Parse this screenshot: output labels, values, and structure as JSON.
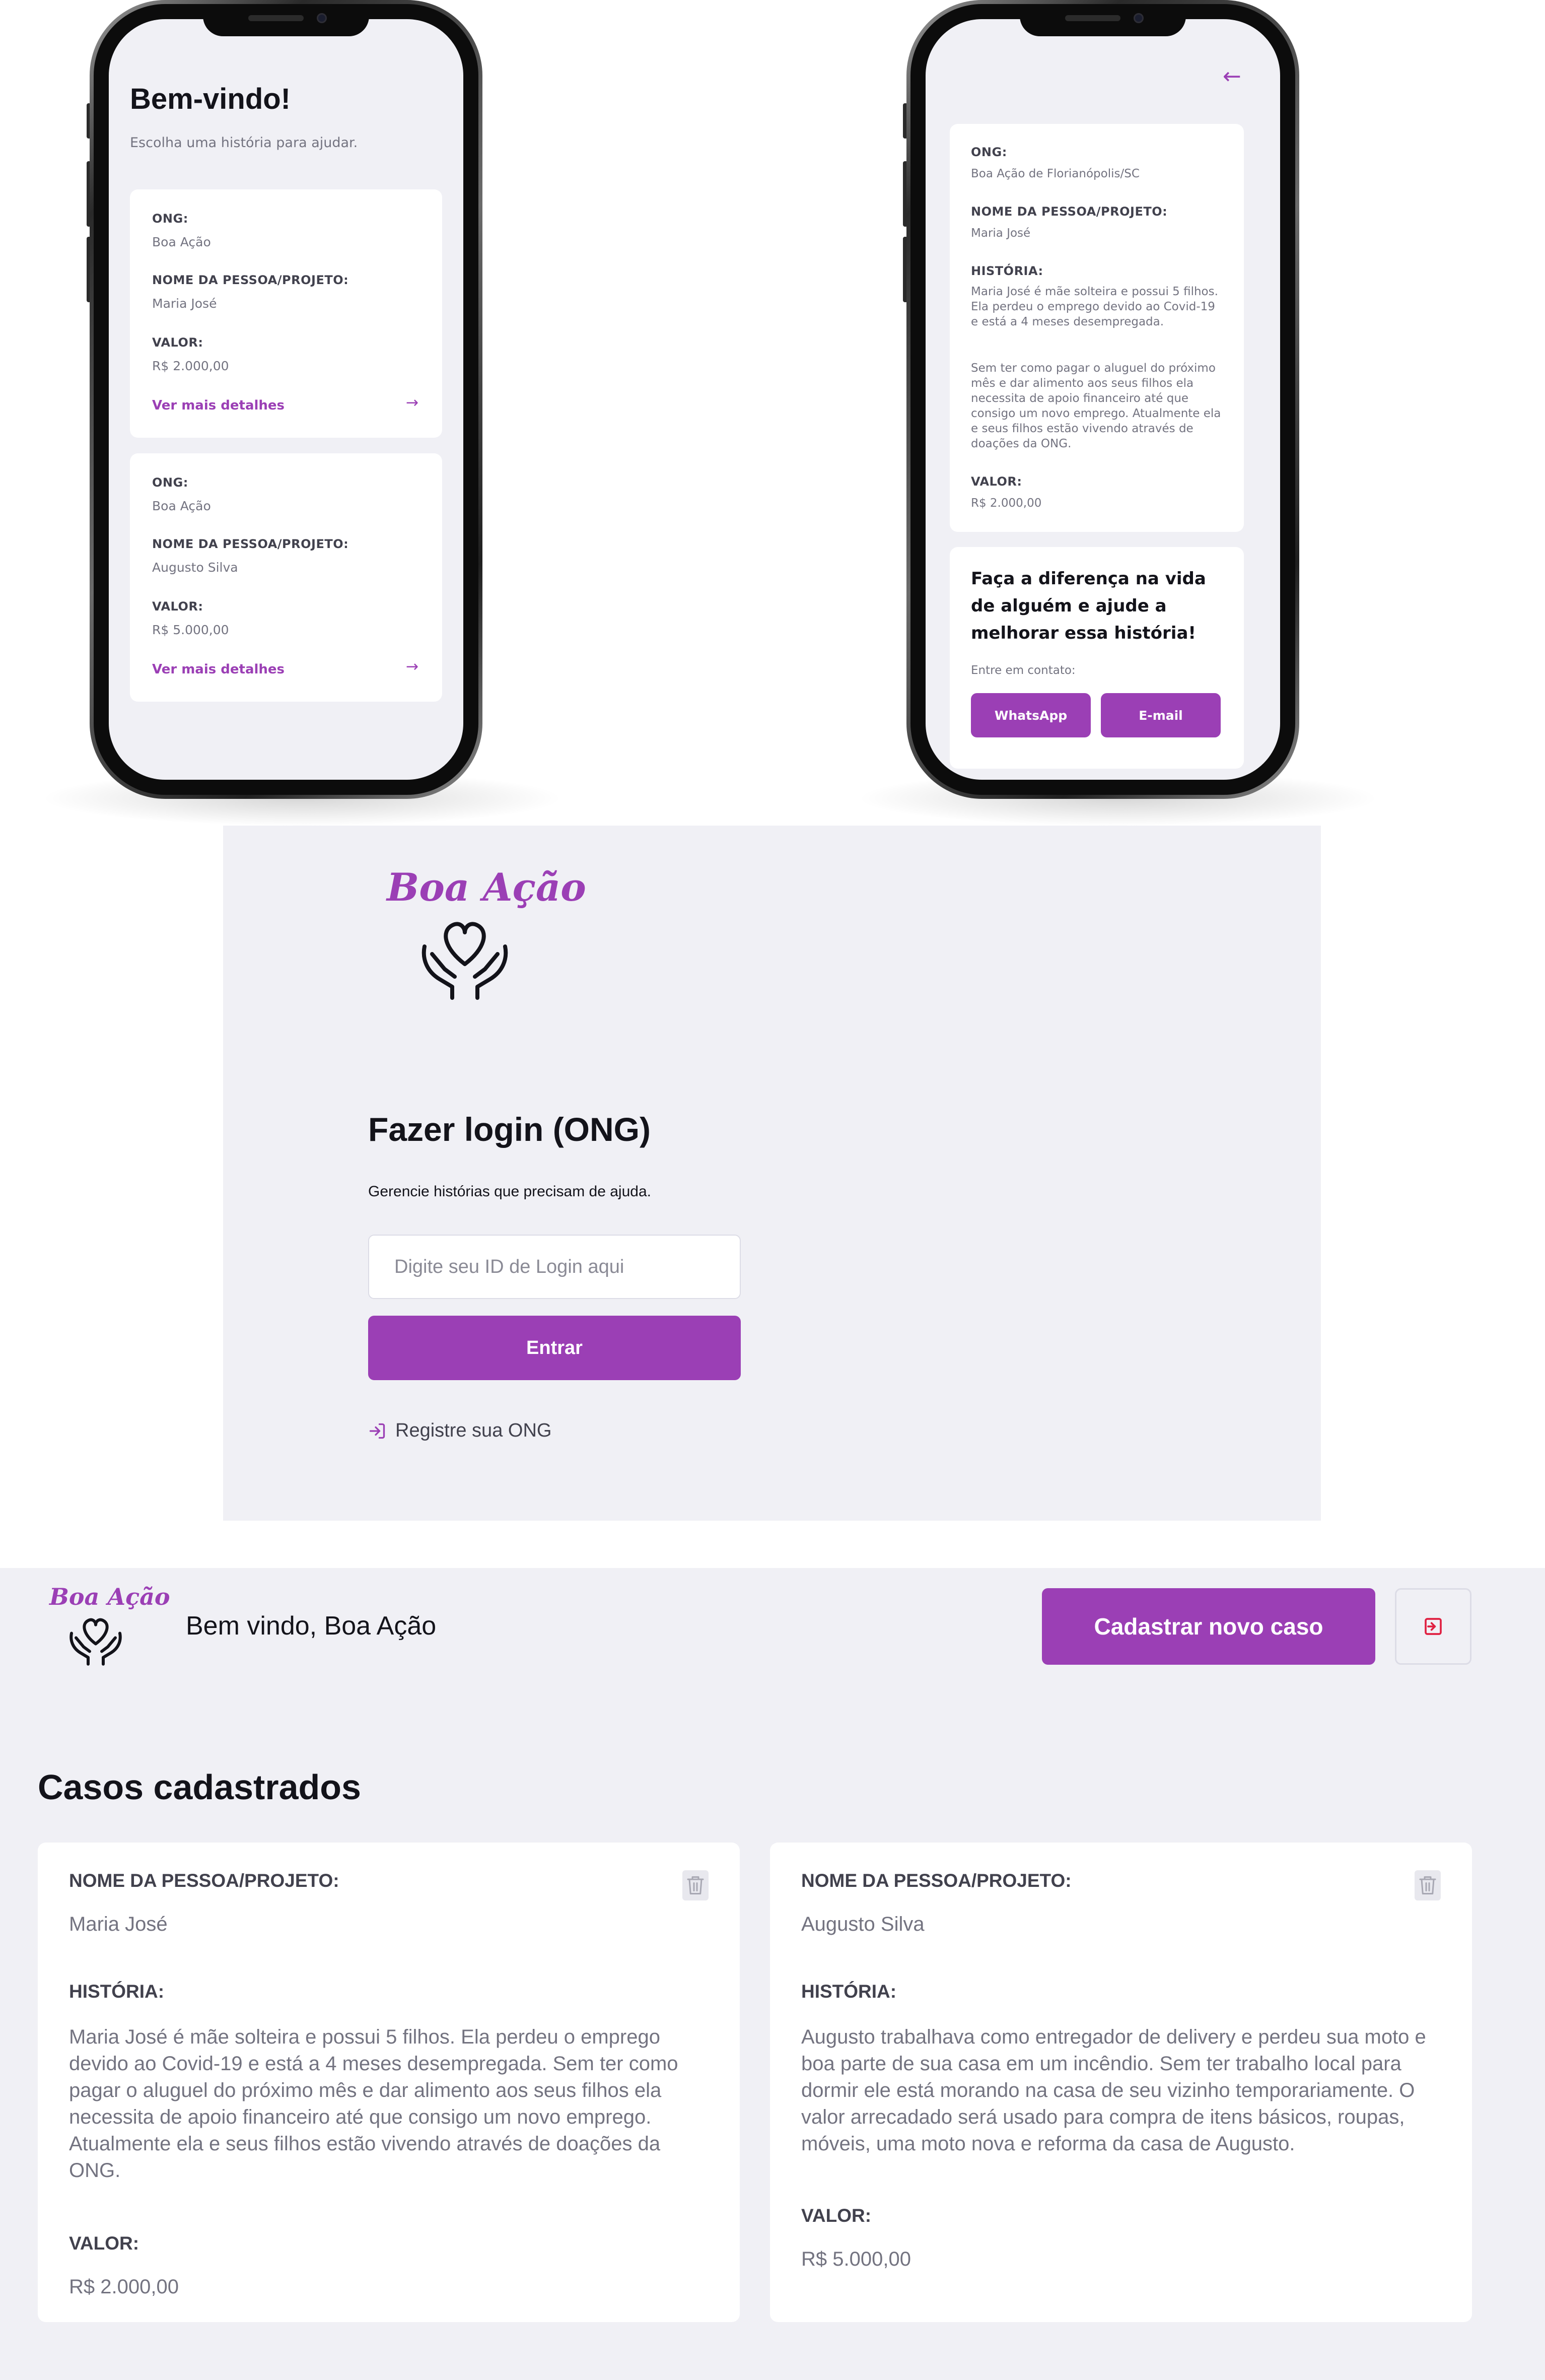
{
  "colors": {
    "accent": "#9b3fb5",
    "background": "#f0f0f5",
    "card": "#ffffff",
    "text_dark": "#13131a",
    "text_muted": "#737380",
    "label": "#41414d"
  },
  "phone_list": {
    "title": "Bem-vindo!",
    "subtitle": "Escolha uma história para ajudar.",
    "cards": [
      {
        "ong_label": "ONG:",
        "ong": "Boa Ação",
        "name_label": "NOME DA PESSOA/PROJETO:",
        "name": "Maria José",
        "value_label": "VALOR:",
        "value": "R$ 2.000,00",
        "link": "Ver mais detalhes"
      },
      {
        "ong_label": "ONG:",
        "ong": "Boa Ação",
        "name_label": "NOME DA PESSOA/PROJETO:",
        "name": "Augusto Silva",
        "value_label": "VALOR:",
        "value": "R$ 5.000,00",
        "link": "Ver mais detalhes"
      }
    ]
  },
  "phone_detail": {
    "ong_label": "ONG:",
    "ong": "Boa Ação de Florianópolis/SC",
    "name_label": "NOME DA PESSOA/PROJETO:",
    "name": "Maria José",
    "story_label": "HISTÓRIA:",
    "story_p1": "Maria José é mãe solteira e possui 5 filhos. Ela perdeu o emprego devido ao Covid-19 e está a 4 meses desempregada.",
    "story_p2": "Sem ter como pagar o aluguel do próximo mês e dar alimento aos seus filhos ela necessita de apoio financeiro até que consigo um novo emprego. Atualmente ela e seus filhos estão vivendo através de doações da ONG.",
    "value_label": "VALOR:",
    "value": "R$ 2.000,00",
    "cta": "Faça a diferença na vida de alguém e ajude a melhorar essa história!",
    "contact_label": "Entre em contato:",
    "whatsapp": "WhatsApp",
    "email": "E-mail"
  },
  "login": {
    "logo": "Boa Ação",
    "title": "Fazer login (ONG)",
    "subtitle": "Gerencie histórias que precisam de ajuda.",
    "input_placeholder": "Digite seu ID de Login aqui",
    "submit": "Entrar",
    "register": "Registre sua ONG"
  },
  "dashboard": {
    "logo": "Boa Ação",
    "welcome": "Bem vindo, Boa Ação",
    "new_case": "Cadastrar novo caso",
    "title": "Casos cadastrados",
    "cases": [
      {
        "name_label": "NOME DA PESSOA/PROJETO:",
        "name": "Maria José",
        "story_label": "HISTÓRIA:",
        "story": "Maria José é mãe solteira e possui 5 filhos. Ela perdeu o emprego devido ao Covid-19 e está a 4 meses desempregada. Sem ter como pagar o aluguel do próximo mês e dar alimento aos seus filhos ela necessita de apoio financeiro até que consigo um novo emprego. Atualmente ela e seus filhos estão vivendo através de doações da ONG.",
        "value_label": "VALOR:",
        "value": "R$ 2.000,00"
      },
      {
        "name_label": "NOME DA PESSOA/PROJETO:",
        "name": "Augusto Silva",
        "story_label": "HISTÓRIA:",
        "story": "Augusto trabalhava como entregador de delivery e perdeu sua moto e boa parte de sua casa em um incêndio. Sem ter trabalho local para dormir ele está morando na casa de seu vizinho temporariamente. O valor arrecadado será usado para compra de itens básicos, roupas, móveis, uma moto nova e reforma da casa de Augusto.",
        "value_label": "VALOR:",
        "value": "R$ 5.000,00"
      }
    ]
  }
}
